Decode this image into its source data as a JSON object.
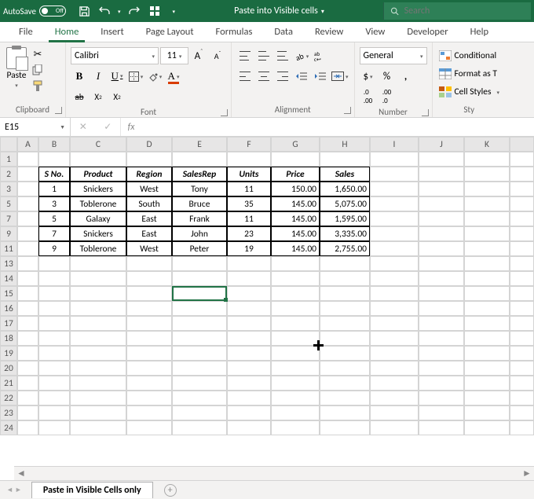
{
  "titlebar": {
    "autosave_label": "AutoSave",
    "autosave_state": "Off",
    "filename": "Paste into Visible cells",
    "search_placeholder": "Search"
  },
  "tabs": [
    "File",
    "Home",
    "Insert",
    "Page Layout",
    "Formulas",
    "Data",
    "Review",
    "View",
    "Developer",
    "Help"
  ],
  "active_tab": "Home",
  "ribbon": {
    "clipboard": {
      "label": "Clipboard",
      "paste": "Paste"
    },
    "font": {
      "label": "Font",
      "name": "Calibri",
      "size": "11"
    },
    "alignment": {
      "label": "Alignment"
    },
    "number": {
      "label": "Number",
      "format": "General"
    },
    "styles": {
      "label": "Sty",
      "conditional": "Conditional",
      "format_as": "Format as T",
      "cell_styles": "Cell Styles"
    }
  },
  "namebox": "E15",
  "columns": [
    "A",
    "B",
    "C",
    "D",
    "E",
    "F",
    "G",
    "H",
    "I",
    "J",
    "K"
  ],
  "row_headers": [
    "1",
    "2",
    "3",
    "5",
    "7",
    "9",
    "11",
    "13",
    "14",
    "15",
    "16",
    "17",
    "18",
    "19",
    "20",
    "21",
    "22",
    "23",
    "24"
  ],
  "table": {
    "headers": [
      "S No.",
      "Product",
      "Region",
      "SalesRep",
      "Units",
      "Price",
      "Sales"
    ],
    "rows": [
      {
        "sno": "1",
        "product": "Snickers",
        "region": "West",
        "rep": "Tony",
        "units": "11",
        "price": "150.00",
        "sales": "1,650.00"
      },
      {
        "sno": "3",
        "product": "Toblerone",
        "region": "South",
        "rep": "Bruce",
        "units": "35",
        "price": "145.00",
        "sales": "5,075.00"
      },
      {
        "sno": "5",
        "product": "Galaxy",
        "region": "East",
        "rep": "Frank",
        "units": "11",
        "price": "145.00",
        "sales": "1,595.00"
      },
      {
        "sno": "7",
        "product": "Snickers",
        "region": "East",
        "rep": "John",
        "units": "23",
        "price": "145.00",
        "sales": "3,335.00"
      },
      {
        "sno": "9",
        "product": "Toblerone",
        "region": "West",
        "rep": "Peter",
        "units": "19",
        "price": "145.00",
        "sales": "2,755.00"
      }
    ]
  },
  "sheet_tab": "Paste in Visible Cells only"
}
